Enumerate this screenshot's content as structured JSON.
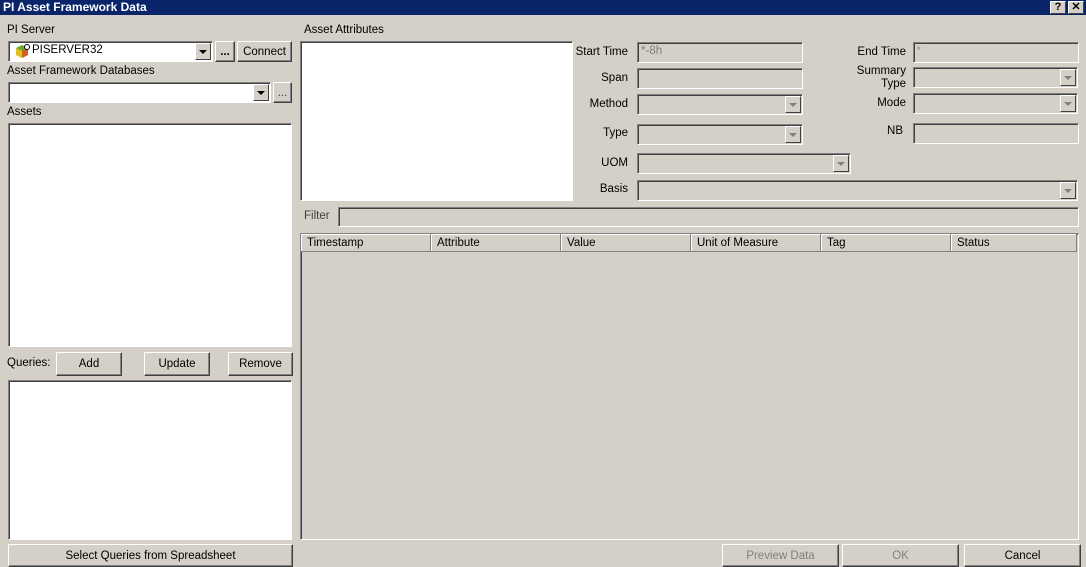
{
  "window": {
    "title": "PI Asset Framework Data",
    "help": "?",
    "close": "✕"
  },
  "left": {
    "pi_server_label": "PI Server",
    "pi_server_value": "PISERVER32",
    "browse": "...",
    "connect": "Connect",
    "af_db_label": "Asset Framework Databases",
    "af_db_value": "",
    "af_browse": "...",
    "assets_label": "Assets",
    "queries_label": "Queries:",
    "add": "Add",
    "update": "Update",
    "remove": "Remove",
    "select_queries": "Select Queries from Spreadsheet"
  },
  "right": {
    "asset_attributes_label": "Asset Attributes",
    "start_time_label": "Start Time",
    "start_time": "*-8h",
    "end_time_label": "End Time",
    "end_time": "*",
    "span_label": "Span",
    "summary_type_label_1": "Summary",
    "summary_type_label_2": "Type",
    "method_label": "Method",
    "mode_label": "Mode",
    "type_label": "Type",
    "nb_label": "NB",
    "uom_label": "UOM",
    "basis_label": "Basis",
    "filter_label": "Filter",
    "columns": [
      "Timestamp",
      "Attribute",
      "Value",
      "Unit of Measure",
      "Tag",
      "Status"
    ]
  },
  "footer": {
    "preview": "Preview Data",
    "ok": "OK",
    "cancel": "Cancel"
  }
}
